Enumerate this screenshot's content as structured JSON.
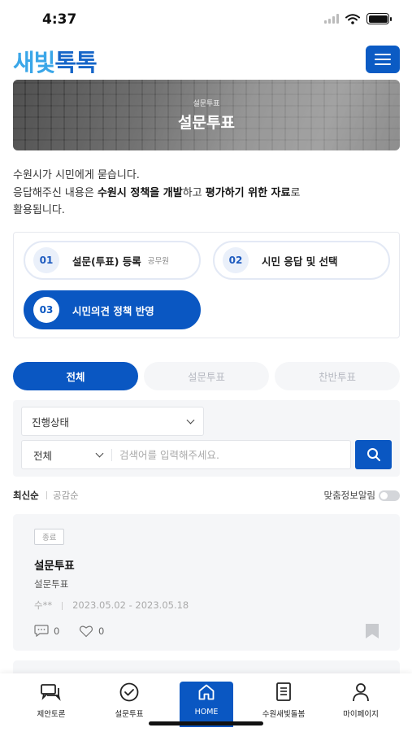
{
  "status": {
    "time": "4:37"
  },
  "header": {
    "logo_part1": "새빛",
    "logo_part2": "톡톡"
  },
  "banner": {
    "subtitle": "설문투표",
    "title": "설문투표"
  },
  "intro": {
    "line1": "수원시가 시민에게 묻습니다.",
    "line2_a": "응답해주신 내용은 ",
    "line2_b": "수원시 정책을 개발",
    "line2_c": "하고 ",
    "line2_d": "평가하기 위한 자료",
    "line2_e": "로",
    "line3": "활용됩니다."
  },
  "steps": [
    {
      "num": "01",
      "label": "설문(투표) 등록",
      "role": "공무원"
    },
    {
      "num": "02",
      "label": "시민 응답 및 선택",
      "role": ""
    },
    {
      "num": "03",
      "label": "시민의견 정책 반영",
      "role": ""
    }
  ],
  "tabs": [
    {
      "label": "전체",
      "active": true
    },
    {
      "label": "설문투표",
      "active": false
    },
    {
      "label": "찬반투표",
      "active": false
    }
  ],
  "filter": {
    "status_select": "진행상태",
    "search_scope": "전체",
    "search_placeholder": "검색어를 입력해주세요."
  },
  "sort": {
    "latest": "최신순",
    "empathy": "공감순",
    "alarm": "맞춤정보알림"
  },
  "card": {
    "badge": "종료",
    "title": "설문투표",
    "category": "설문투표",
    "author": "수**",
    "period": "2023.05.02 - 2023.05.18",
    "comments": "0",
    "likes": "0"
  },
  "bottom_nav": [
    {
      "label": "제안토론",
      "icon": "discussion-icon"
    },
    {
      "label": "설문투표",
      "icon": "check-circle-icon"
    },
    {
      "label": "HOME",
      "icon": "home-icon"
    },
    {
      "label": "수원새빛돌봄",
      "icon": "document-icon"
    },
    {
      "label": "마이페이지",
      "icon": "person-icon"
    }
  ],
  "colors": {
    "primary": "#0a57c2",
    "logo_light": "#3aa6e8",
    "panel_bg": "#f5f6f8"
  }
}
